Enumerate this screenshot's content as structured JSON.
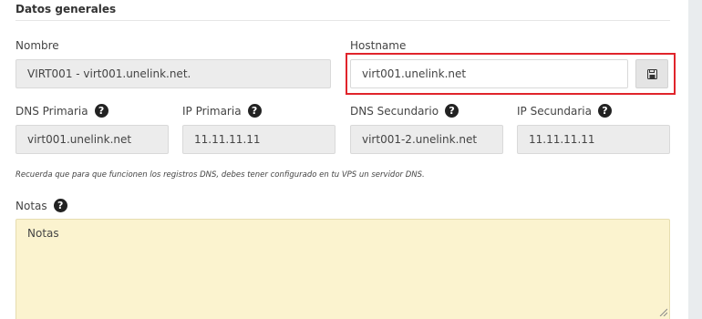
{
  "section": {
    "title": "Datos generales"
  },
  "fields": {
    "nombre": {
      "label": "Nombre",
      "value": "VIRT001 - virt001.unelink.net."
    },
    "hostname": {
      "label": "Hostname",
      "value": "virt001.unelink.net",
      "action_icon": "save-icon"
    },
    "dns_primaria": {
      "label": "DNS Primaria",
      "value": "virt001.unelink.net",
      "help_icon": "question-circle-icon"
    },
    "ip_primaria": {
      "label": "IP Primaria",
      "value": "11.11.11.11",
      "help_icon": "question-circle-icon"
    },
    "dns_secundario": {
      "label": "DNS Secundario",
      "value": "virt001-2.unelink.net",
      "help_icon": "question-circle-icon"
    },
    "ip_secundaria": {
      "label": "IP Secundaria",
      "value": "11.11.11.11",
      "help_icon": "question-circle-icon"
    }
  },
  "hint": "Recuerda que para que funcionen los registros DNS, debes tener configurado en tu VPS un servidor DNS.",
  "notas": {
    "label": "Notas",
    "placeholder": "Notas",
    "help_icon": "question-circle-icon"
  },
  "colors": {
    "highlight_border": "#e0242b",
    "notes_background": "#fbf3cf",
    "readonly_background": "#ececec"
  }
}
